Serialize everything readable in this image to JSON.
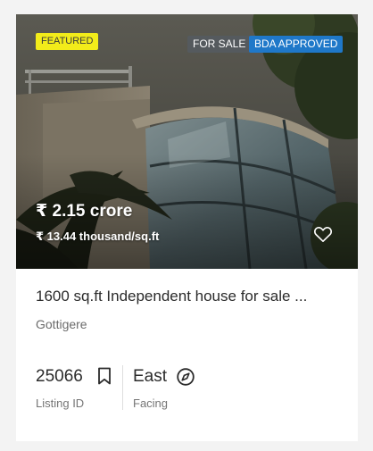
{
  "listing": {
    "badges": {
      "featured": "FEATURED",
      "sale": "FOR SALE",
      "approval": "BDA APPROVED"
    },
    "price": "₹ 2.15 crore",
    "price_per_sqft": "₹ 13.44 thousand/sq.ft",
    "title": "1600 sq.ft Independent house for sale ...",
    "locality": "Gottigere",
    "listing_id": {
      "value": "25066",
      "label": "Listing ID",
      "icon": "bookmark-icon"
    },
    "facing": {
      "value": "East",
      "label": "Facing",
      "icon": "compass-icon"
    },
    "favorite_icon": "heart-icon"
  },
  "colors": {
    "featured_badge": "#f2ec1a",
    "sale_badge": "#555a5e",
    "approval_badge": "#1f78c9"
  }
}
